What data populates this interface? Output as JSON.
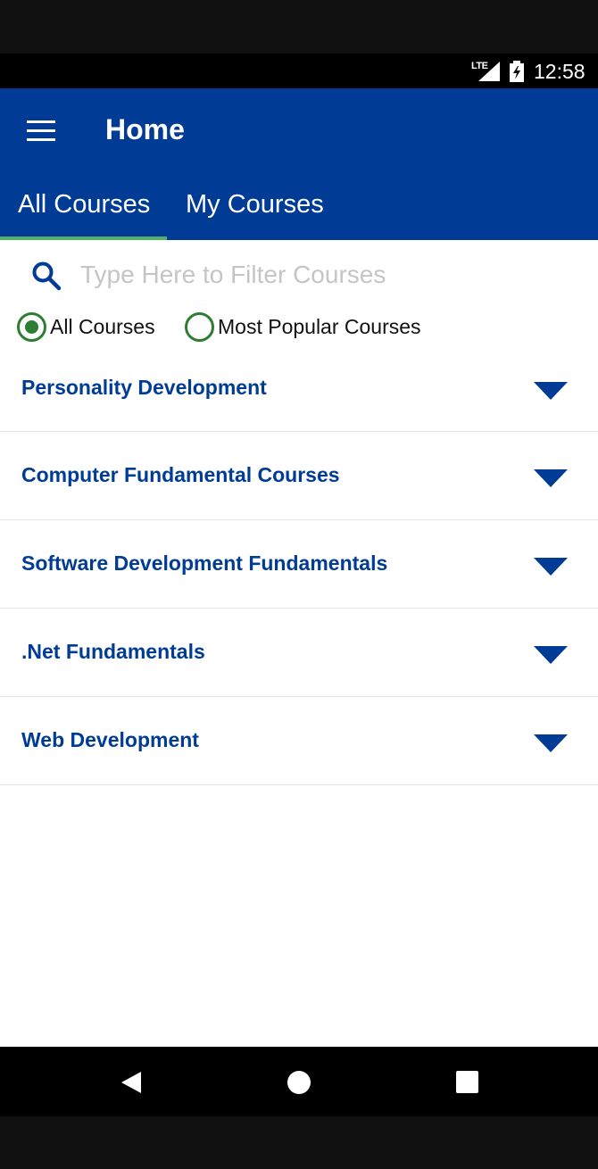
{
  "status_bar": {
    "network": "LTE",
    "time": "12:58"
  },
  "app_bar": {
    "title": "Home",
    "menu_icon": "hamburger-menu-icon"
  },
  "tabs": [
    {
      "label": "All Courses",
      "selected": true
    },
    {
      "label": "My Courses",
      "selected": false
    }
  ],
  "search": {
    "placeholder": "Type Here to Filter Courses",
    "value": "",
    "icon": "search-icon"
  },
  "filters": [
    {
      "label": "All Courses",
      "selected": true
    },
    {
      "label": "Most Popular Courses",
      "selected": false
    }
  ],
  "courses": [
    {
      "title": "Personality Development"
    },
    {
      "title": "Computer Fundamental Courses"
    },
    {
      "title": "Software Development Fundamentals"
    },
    {
      "title": ".Net Fundamentals"
    },
    {
      "title": "Web Development"
    }
  ],
  "colors": {
    "app_bar": "#003c96",
    "tab_indicator": "#52b06b",
    "radio": "#2e7d32",
    "course_text": "#003c96"
  },
  "nav_bar": {
    "icons": [
      "back-icon",
      "home-icon",
      "recents-icon"
    ]
  }
}
